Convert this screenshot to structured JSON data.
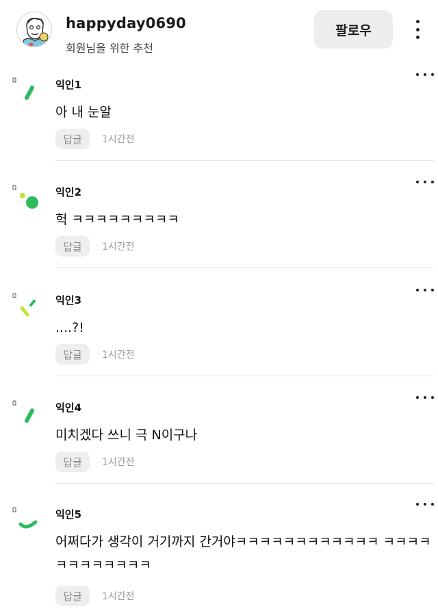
{
  "header": {
    "username": "happyday0690",
    "subtitle": "회원님을 위한 추천",
    "follow_label": "팔로우",
    "avatar_icon": "cartoon-character-avatar-icon",
    "more_icon": "vertical-ellipsis-icon"
  },
  "comments": [
    {
      "name": "익인1",
      "text": "아 내 눈알",
      "reply_label": "답글",
      "time": "1시간전",
      "avatar_icon": "green-stroke-avatar-icon"
    },
    {
      "name": "익인2",
      "text": "헉 ㅋㅋㅋㅋㅋㅋㅋㅋㅋ",
      "reply_label": "답글",
      "time": "1시간전",
      "avatar_icon": "green-dots-avatar-icon"
    },
    {
      "name": "익인3",
      "text": "....?!",
      "reply_label": "답글",
      "time": "1시간전",
      "avatar_icon": "lime-strokes-avatar-icon"
    },
    {
      "name": "익인4",
      "text": "미치겠다 쓰니 극 N이구나",
      "reply_label": "답글",
      "time": "1시간전",
      "avatar_icon": "green-stroke-avatar-icon"
    },
    {
      "name": "익인5",
      "text": "어쩌다가 생각이 거기까지 간거야ㅋㅋㅋㅋㅋㅋㅋㅋㅋㅋㅋㅋ ㅋㅋㅋㅋㅋㅋㅋㅋㅋㅋㅋㅋ",
      "reply_label": "답글",
      "time": "1시간전",
      "avatar_icon": "green-arc-avatar-icon"
    }
  ],
  "colors": {
    "accent_green": "#2dbb5d",
    "lime": "#c8de3a",
    "button_bg": "#eeeeee",
    "meta_gray": "#9a9a9a"
  }
}
